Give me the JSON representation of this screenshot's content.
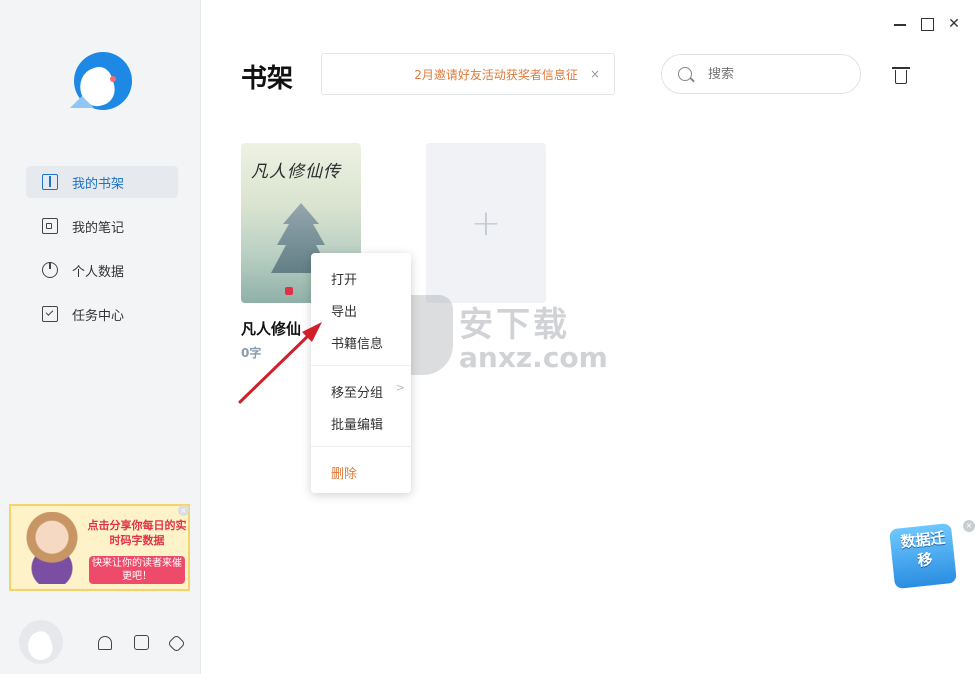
{
  "window": {
    "minimize_label": "",
    "maximize_label": "",
    "close_label": "✕"
  },
  "sidebar": {
    "items": [
      {
        "label": "我的书架",
        "icon": "bookshelf-icon",
        "active": true
      },
      {
        "label": "我的笔记",
        "icon": "notes-icon",
        "active": false
      },
      {
        "label": "个人数据",
        "icon": "pie-chart-icon",
        "active": false
      },
      {
        "label": "任务中心",
        "icon": "task-icon",
        "active": false
      }
    ],
    "promo": {
      "line1": "点击分享你每日的实时码字数据",
      "line2": "快来让你的读者来催更吧！"
    },
    "footer_icons": [
      "bell-icon",
      "shirt-icon",
      "settings-icon"
    ]
  },
  "header": {
    "title": "书架",
    "notice": "2月邀请好友活动获奖者信息征",
    "notice_close": "×",
    "search_placeholder": "搜索"
  },
  "books": [
    {
      "cover_title": "凡人修仙传",
      "title": "凡人修仙",
      "words": "0字"
    }
  ],
  "add_book_label": "+",
  "context_menu": {
    "open": "打开",
    "export": "导出",
    "info": "书籍信息",
    "move_group": "移至分组",
    "batch_edit": "批量编辑",
    "delete": "删除",
    "submenu_chevron": ">"
  },
  "watermark": {
    "line1": "安下载",
    "line2": "anxz.com"
  },
  "migrate": {
    "label": "数据迁移",
    "close": "×"
  },
  "colors": {
    "accent": "#1a73c9",
    "warning": "#e07a3a",
    "arrow": "#d0202a"
  }
}
